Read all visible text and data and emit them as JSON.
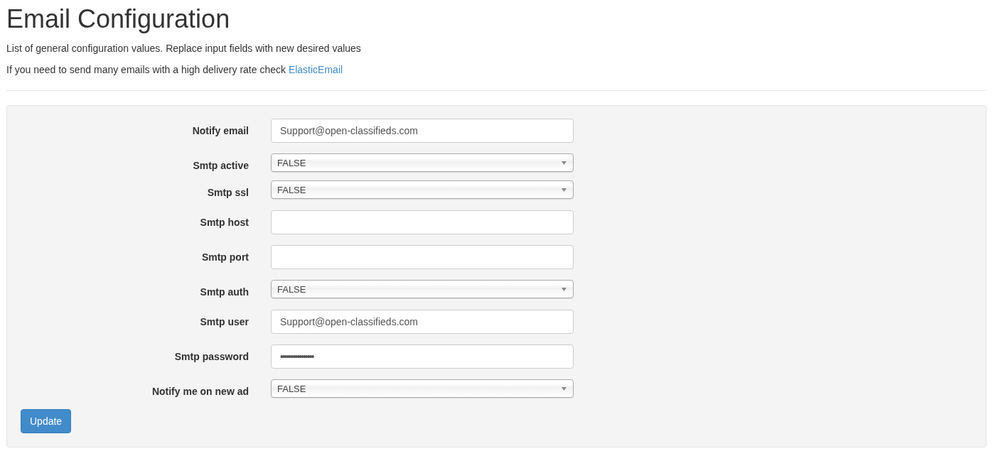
{
  "title": "Email Configuration",
  "description": "List of general configuration values. Replace input fields with new desired values",
  "note": {
    "text": "If you need to send many emails with a high delivery rate check",
    "link": "ElasticEmail"
  },
  "fields": [
    {
      "label": "Notify email",
      "kind": "text",
      "value": "Support@open-classifieds.com"
    },
    {
      "label": "Smtp active",
      "kind": "select",
      "value": "FALSE"
    },
    {
      "label": "Smtp ssl",
      "kind": "select",
      "value": "FALSE"
    },
    {
      "label": "Smtp host",
      "kind": "text"
    },
    {
      "label": "Smtp port",
      "kind": "text"
    },
    {
      "label": "Smtp auth",
      "kind": "select",
      "value": "FALSE"
    },
    {
      "label": "Smtp user",
      "kind": "text",
      "value": "Support@open-classifieds.com"
    },
    {
      "label": "Smtp password",
      "kind": "password",
      "value": "••••••••••••••••"
    },
    {
      "label": "Notify me on new ad",
      "kind": "select",
      "value": "FALSE"
    }
  ],
  "button": "Update"
}
